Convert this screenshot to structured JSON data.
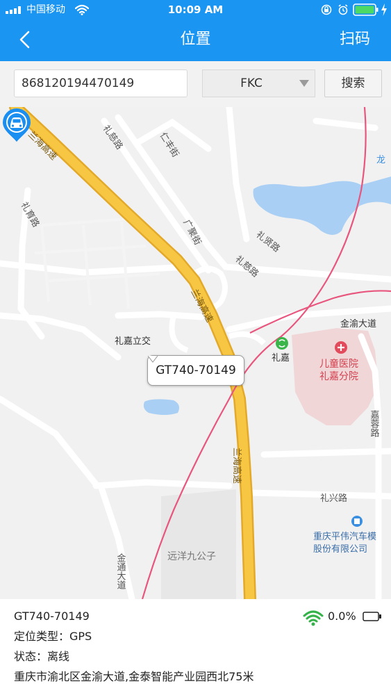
{
  "status_bar": {
    "carrier": "中国移动",
    "time": "10:09 AM"
  },
  "nav": {
    "title": "位置",
    "scan_label": "扫码",
    "back_icon": "chevron-left-icon"
  },
  "search": {
    "imei_value": "868120194470149",
    "type_selected": "FKC",
    "search_label": "搜索"
  },
  "map": {
    "labels": {
      "lanhai_1": "兰海高速",
      "lanhai_2": "兰海高速",
      "lanhai_3": "兰海高速",
      "lici_1": "礼慈路",
      "lici_2": "礼慈路",
      "liyu": "礼育路",
      "renfeng": "仁丰街",
      "guangju": "广聚街",
      "lixian": "礼贤路",
      "lijia_interchange": "礼嘉立交",
      "jinyu_avenue": "金渝大道",
      "lijia_station": "礼嘉",
      "hospital_1": "儿童医院",
      "hospital_2": "礼嘉分院",
      "jiarong": "嘉蓉路",
      "lixing": "礼兴路",
      "pingwei_1": "重庆平伟汽车模",
      "pingwei_2": "股份有限公司",
      "yuanyang": "远洋九公子",
      "jintong": "金通大道",
      "long": "龙"
    },
    "colors": {
      "highway": "#F7C744",
      "highway_edge": "#E3A92A",
      "rail": "#E8557D",
      "water": "#A9CFF4",
      "hospital": "#F1D6D8"
    }
  },
  "device": {
    "name": "GT740-70149",
    "marker_icon": "car-location-pin-icon"
  },
  "info": {
    "device_name": "GT740-70149",
    "location_type": "定位类型：GPS",
    "status": "状态：离线",
    "address": "重庆市渝北区金渝大道,金泰智能产业园西北75米",
    "battery_percent": "0.0%",
    "signal_icon": "signal-strength-icon",
    "battery_icon": "battery-empty-icon"
  }
}
